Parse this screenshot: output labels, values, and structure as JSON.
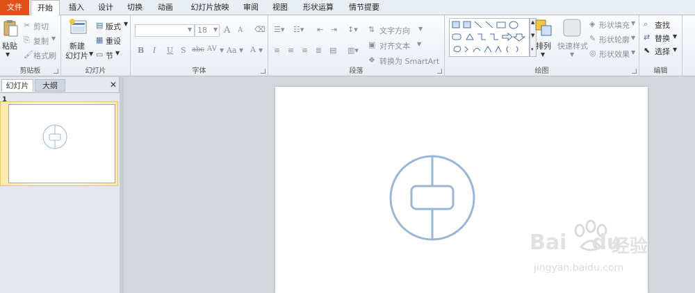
{
  "tabs": [
    {
      "label": "文件",
      "kind": "file"
    },
    {
      "label": "开始",
      "kind": "active"
    },
    {
      "label": "插入"
    },
    {
      "label": "设计"
    },
    {
      "label": "切换"
    },
    {
      "label": "动画"
    },
    {
      "label": "幻灯片放映"
    },
    {
      "label": "审阅"
    },
    {
      "label": "视图"
    },
    {
      "label": "形状运算"
    },
    {
      "label": "情节提要"
    }
  ],
  "ribbon": {
    "clipboard": {
      "label": "剪贴板",
      "paste": "粘贴",
      "cut": "剪切",
      "copy": "复制",
      "format_painter": "格式刷"
    },
    "slides": {
      "label": "幻灯片",
      "new_slide_line1": "新建",
      "new_slide_line2": "幻灯片",
      "layout": "版式",
      "reset": "重设",
      "section": "节"
    },
    "font": {
      "label": "字体",
      "font_size": "18",
      "grow": "A",
      "shrink": "A",
      "bold": "B",
      "italic": "I",
      "underline": "U",
      "shadow": "S",
      "strike": "abc",
      "spacing": "AV",
      "case": "Aa",
      "color": "A"
    },
    "paragraph": {
      "label": "段落",
      "text_direction": "文字方向",
      "align_text": "对齐文本",
      "smartart": "转换为 SmartArt"
    },
    "drawing": {
      "label": "绘图",
      "arrange": "排列",
      "quick_styles": "快速样式",
      "shape_fill": "形状填充",
      "shape_outline": "形状轮廓",
      "shape_effects": "形状效果"
    },
    "editing": {
      "label": "编辑",
      "find": "查找",
      "replace": "替换",
      "select": "选择"
    }
  },
  "left_panel": {
    "tab_slides": "幻灯片",
    "tab_outline": "大纲",
    "close": "✕",
    "slide_number": "1"
  },
  "colors": {
    "file_tab": "#e0501b",
    "shape_stroke": "#9bb5d6",
    "thumb_highlight": "#ffe9a8"
  },
  "watermark": {
    "brand": "Bai",
    "brand2": "du",
    "cn": "经验",
    "url": "jingyan.baidu.com"
  }
}
